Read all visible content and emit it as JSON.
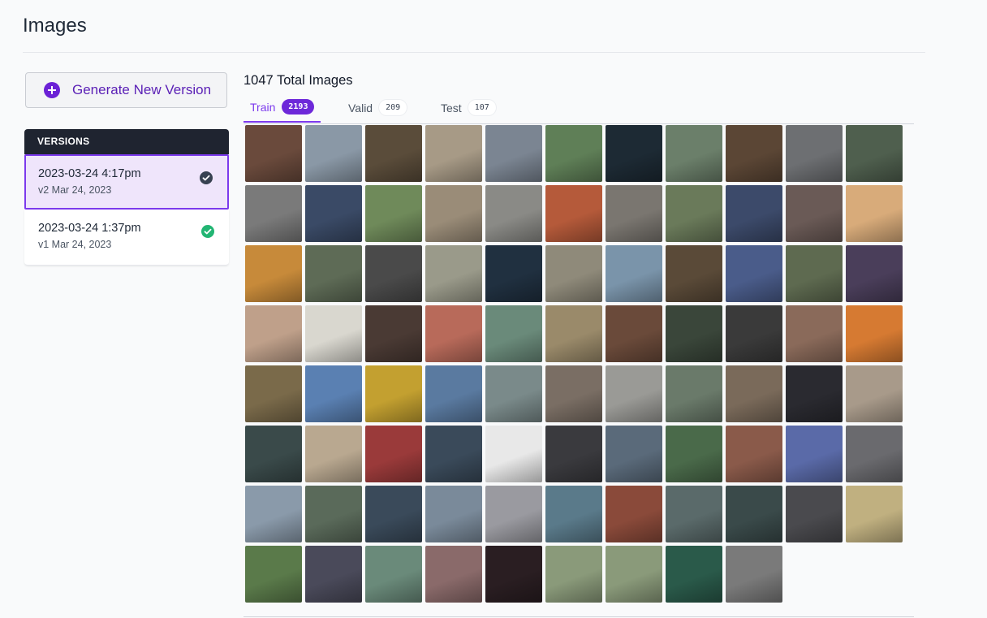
{
  "page": {
    "title": "Images"
  },
  "generate_button": {
    "label": "Generate New Version",
    "icon": "plus-circle-icon"
  },
  "versions": {
    "header": "VERSIONS",
    "items": [
      {
        "date": "2023-03-24 4:17pm",
        "subtitle": "v2 Mar 24, 2023",
        "icon": "check-circle-dark-icon",
        "active": true
      },
      {
        "date": "2023-03-24 1:37pm",
        "subtitle": "v1 Mar 24, 2023",
        "icon": "check-circle-green-icon",
        "active": false
      }
    ]
  },
  "summary": {
    "total_label": "1047 Total Images"
  },
  "tabs": [
    {
      "label": "Train",
      "count": "2193",
      "active": true
    },
    {
      "label": "Valid",
      "count": "209",
      "active": false
    },
    {
      "label": "Test",
      "count": "107",
      "active": false
    }
  ],
  "colors": {
    "accent": "#7c3aed",
    "dark_header": "#1f2430",
    "success": "#22b573"
  },
  "gallery": {
    "thumbnails": [
      "#6a4a3c",
      "#8a98a6",
      "#5a4c3a",
      "#a79a86",
      "#7b8592",
      "#5f7f57",
      "#1d2a34",
      "#6b7f6a",
      "#5b4635",
      "#6d6f72",
      "#4f5f4e",
      "#7a7a7a",
      "#3a4a66",
      "#6f8a5a",
      "#9a8c78",
      "#8a8a86",
      "#b55a3a",
      "#7a7670",
      "#6a7a5a",
      "#3c4a6a",
      "#6a5a56",
      "#d8ab7a",
      "#c78a3a",
      "#5e6b56",
      "#4a4a4a",
      "#9a9a8a",
      "#203040",
      "#8f8a7a",
      "#7a94aa",
      "#5a4a38",
      "#4a5c8a",
      "#5e6a50",
      "#4a3e5a",
      "#bfa08a",
      "#d9d7cf",
      "#4a3a34",
      "#b86a5a",
      "#6a8a7a",
      "#9a8a6a",
      "#6a4a3a",
      "#3a463a",
      "#3a3a3a",
      "#8a6a5a",
      "#d67a32",
      "#7a6a4a",
      "#5a80b2",
      "#c3a030",
      "#5a7aa0",
      "#7a8a8a",
      "#7a6e64",
      "#9a9a96",
      "#6a7a6a",
      "#7a6a5a",
      "#2a2a30",
      "#a89a8a",
      "#3a4a4a",
      "#b9a890",
      "#9a3a3a",
      "#3a4a5a",
      "#e8e8e8",
      "#3a3a3e",
      "#5a6a7a",
      "#4a6a4a",
      "#8a5a4a",
      "#5a6aa8",
      "#6a6a6e",
      "#8a9aaa",
      "#5a6a5a",
      "#3a4a5a",
      "#7a8a9a",
      "#9a9aa0",
      "#5a7a8a",
      "#8a4a3a",
      "#5a6a6a",
      "#3a4a4a",
      "#4a4a4e",
      "#c0b080",
      "#5a7a4a",
      "#4a4a5a",
      "#6a8a7a",
      "#8a6a6a",
      "#2a1e22",
      "#8a9a7a",
      "#8a9a7a",
      "#2a5a4a",
      "#7a7a7a"
    ]
  }
}
